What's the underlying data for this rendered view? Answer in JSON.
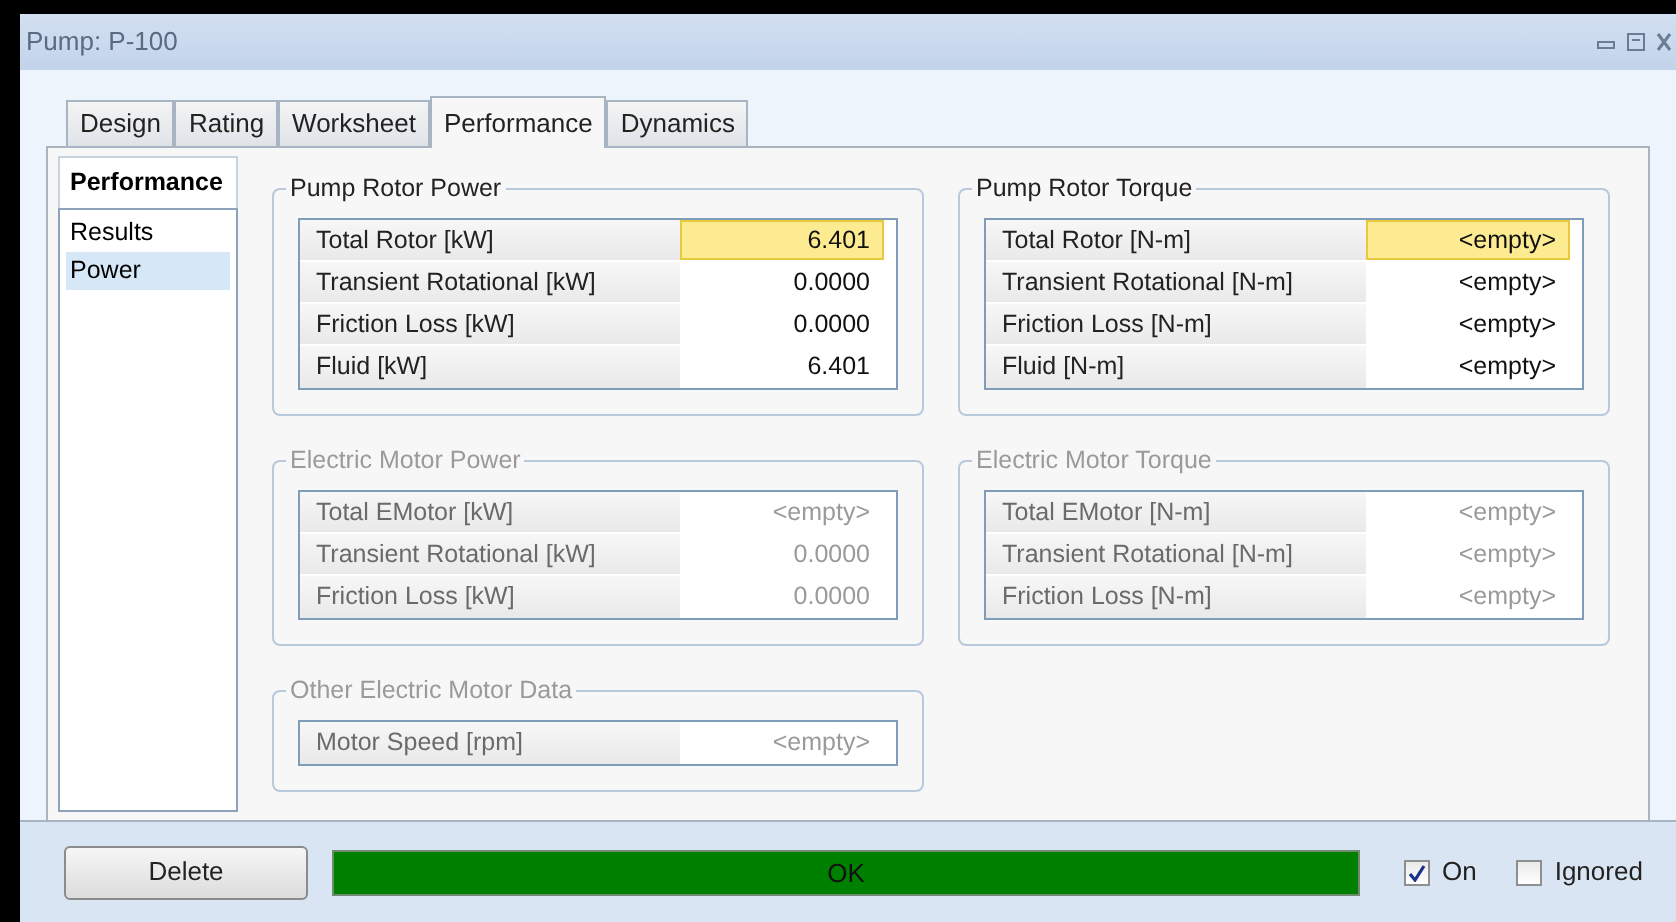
{
  "window": {
    "title": "Pump: P-100"
  },
  "tabs": [
    {
      "label": "Design",
      "selected": false
    },
    {
      "label": "Rating",
      "selected": false
    },
    {
      "label": "Worksheet",
      "selected": false
    },
    {
      "label": "Performance",
      "selected": true
    },
    {
      "label": "Dynamics",
      "selected": false
    }
  ],
  "sidebar": {
    "title": "Performance",
    "items": [
      {
        "label": "Results",
        "selected": false
      },
      {
        "label": "Power",
        "selected": true
      }
    ]
  },
  "groups": [
    {
      "title": "Pump Rotor Power",
      "disabled": false,
      "rows": [
        {
          "label": "Total Rotor [kW]",
          "value": "6.401",
          "selected": true
        },
        {
          "label": "Transient Rotational [kW]",
          "value": "0.0000",
          "selected": false
        },
        {
          "label": "Friction Loss [kW]",
          "value": "0.0000",
          "selected": false
        },
        {
          "label": "Fluid [kW]",
          "value": "6.401",
          "selected": false
        }
      ]
    },
    {
      "title": "Pump Rotor Torque",
      "disabled": false,
      "rows": [
        {
          "label": "Total Rotor [N-m]",
          "value": "<empty>",
          "selected": true
        },
        {
          "label": "Transient Rotational [N-m]",
          "value": "<empty>",
          "selected": false
        },
        {
          "label": "Friction Loss [N-m]",
          "value": "<empty>",
          "selected": false
        },
        {
          "label": "Fluid [N-m]",
          "value": "<empty>",
          "selected": false
        }
      ]
    },
    {
      "title": "Electric Motor Power",
      "disabled": true,
      "rows": [
        {
          "label": "Total EMotor [kW]",
          "value": "<empty>",
          "selected": false
        },
        {
          "label": "Transient Rotational [kW]",
          "value": "0.0000",
          "selected": false
        },
        {
          "label": "Friction Loss [kW]",
          "value": "0.0000",
          "selected": false
        }
      ]
    },
    {
      "title": "Electric Motor Torque",
      "disabled": true,
      "rows": [
        {
          "label": "Total EMotor [N-m]",
          "value": "<empty>",
          "selected": false
        },
        {
          "label": "Transient Rotational [N-m]",
          "value": "<empty>",
          "selected": false
        },
        {
          "label": "Friction Loss [N-m]",
          "value": "<empty>",
          "selected": false
        }
      ]
    },
    {
      "title": "Other Electric Motor Data",
      "disabled": true,
      "rows": [
        {
          "label": "Motor Speed [rpm]",
          "value": "<empty>",
          "selected": false
        }
      ]
    }
  ],
  "bottom": {
    "delete_button": "Delete",
    "status": {
      "text": "OK",
      "color": "#008000"
    },
    "checkboxes": [
      {
        "label": "On",
        "checked": true
      },
      {
        "label": "Ignored",
        "checked": false
      }
    ]
  }
}
